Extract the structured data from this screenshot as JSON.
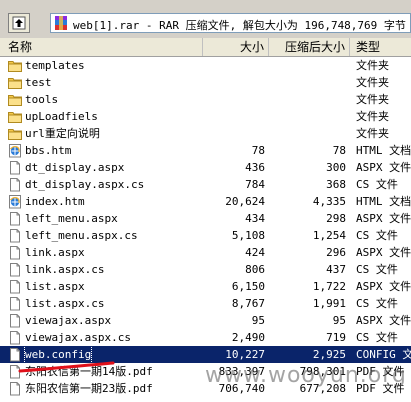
{
  "window": {
    "path_text": "web[1].rar - RAR 压缩文件, 解包大小为 196,748,769 字节"
  },
  "columns": {
    "name": "名称",
    "size": "大小",
    "packed": "压缩后大小",
    "type": "类型"
  },
  "files": [
    {
      "name": "templates",
      "size": "",
      "packed": "",
      "type": "文件夹",
      "icon": "folder-icon"
    },
    {
      "name": "test",
      "size": "",
      "packed": "",
      "type": "文件夹",
      "icon": "folder-icon"
    },
    {
      "name": "tools",
      "size": "",
      "packed": "",
      "type": "文件夹",
      "icon": "folder-icon"
    },
    {
      "name": "upLoadfiels",
      "size": "",
      "packed": "",
      "type": "文件夹",
      "icon": "folder-icon"
    },
    {
      "name": "url重定向说明",
      "size": "",
      "packed": "",
      "type": "文件夹",
      "icon": "folder-icon"
    },
    {
      "name": "bbs.htm",
      "size": "78",
      "packed": "78",
      "type": "HTML 文档",
      "icon": "html-icon"
    },
    {
      "name": "dt_display.aspx",
      "size": "436",
      "packed": "300",
      "type": "ASPX 文件",
      "icon": "file-icon"
    },
    {
      "name": "dt_display.aspx.cs",
      "size": "784",
      "packed": "368",
      "type": "CS 文件",
      "icon": "file-icon"
    },
    {
      "name": "index.htm",
      "size": "20,624",
      "packed": "4,335",
      "type": "HTML 文档",
      "icon": "html-icon"
    },
    {
      "name": "left_menu.aspx",
      "size": "434",
      "packed": "298",
      "type": "ASPX 文件",
      "icon": "file-icon"
    },
    {
      "name": "left_menu.aspx.cs",
      "size": "5,108",
      "packed": "1,254",
      "type": "CS 文件",
      "icon": "file-icon"
    },
    {
      "name": "link.aspx",
      "size": "424",
      "packed": "296",
      "type": "ASPX 文件",
      "icon": "file-icon"
    },
    {
      "name": "link.aspx.cs",
      "size": "806",
      "packed": "437",
      "type": "CS 文件",
      "icon": "file-icon"
    },
    {
      "name": "list.aspx",
      "size": "6,150",
      "packed": "1,722",
      "type": "ASPX 文件",
      "icon": "file-icon"
    },
    {
      "name": "list.aspx.cs",
      "size": "8,767",
      "packed": "1,991",
      "type": "CS 文件",
      "icon": "file-icon"
    },
    {
      "name": "viewajax.aspx",
      "size": "95",
      "packed": "95",
      "type": "ASPX 文件",
      "icon": "file-icon"
    },
    {
      "name": "viewajax.aspx.cs",
      "size": "2,490",
      "packed": "719",
      "type": "CS 文件",
      "icon": "file-icon"
    },
    {
      "name": "web.config",
      "size": "10,227",
      "packed": "2,925",
      "type": "CONFIG 文件",
      "icon": "file-icon",
      "selected": true
    },
    {
      "name": "东阳农信第一期14版.pdf",
      "size": "833,397",
      "packed": "798,301",
      "type": "PDF 文件",
      "icon": "file-icon"
    },
    {
      "name": "东阳农信第一期23版.pdf",
      "size": "706,740",
      "packed": "677,208",
      "type": "PDF 文件",
      "icon": "file-icon"
    }
  ],
  "watermark": "www.wooyun.org",
  "colors": {
    "selection": "#0a246a",
    "folder": "#f5c94a",
    "annotation": "#e0101a"
  }
}
